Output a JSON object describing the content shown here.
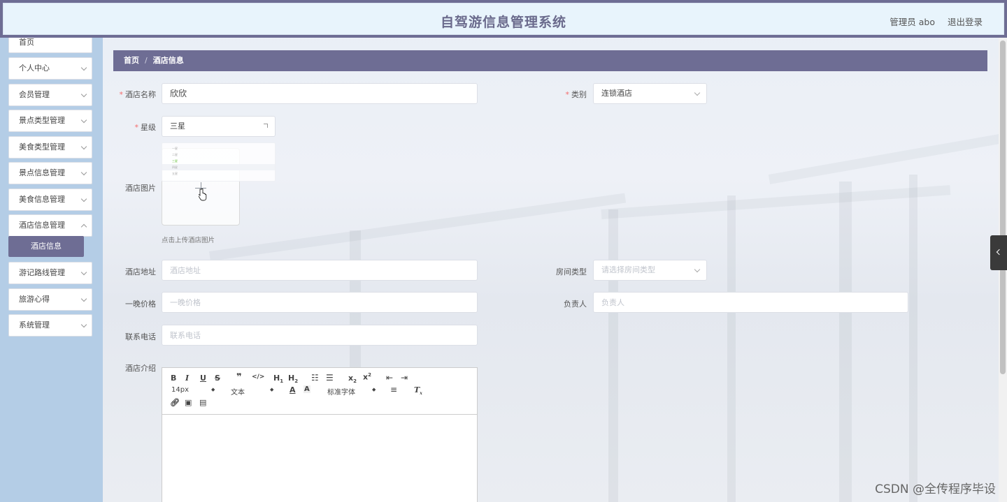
{
  "header": {
    "title": "自驾游信息管理系统",
    "user_label": "管理员 abo",
    "logout_label": "退出登录"
  },
  "sidebar": {
    "items": [
      {
        "label": "首页"
      },
      {
        "label": "个人中心"
      },
      {
        "label": "会员管理"
      },
      {
        "label": "景点类型管理"
      },
      {
        "label": "美食类型管理"
      },
      {
        "label": "景点信息管理"
      },
      {
        "label": "美食信息管理"
      },
      {
        "label": "酒店信息管理"
      },
      {
        "label": "游记路线管理"
      },
      {
        "label": "旅游心得"
      },
      {
        "label": "系统管理"
      }
    ],
    "active_sub": "酒店信息"
  },
  "breadcrumb": {
    "home": "首页",
    "sep": "/",
    "current": "酒店信息"
  },
  "form": {
    "hotel_name": {
      "label": "酒店名称",
      "value": "欣欣"
    },
    "category": {
      "label": "类别",
      "value": "连锁酒店"
    },
    "star": {
      "label": "星级",
      "value": "三星",
      "options": [
        "一星",
        "二星",
        "三星",
        "四星",
        "五星"
      ]
    },
    "image": {
      "label": "酒店图片",
      "tip": "点击上传酒店图片"
    },
    "address": {
      "label": "酒店地址",
      "placeholder": "酒店地址"
    },
    "room_type": {
      "label": "房间类型",
      "placeholder": "请选择房间类型"
    },
    "price": {
      "label": "一晚价格",
      "placeholder": "一晚价格"
    },
    "manager": {
      "label": "负责人",
      "placeholder": "负责人"
    },
    "phone": {
      "label": "联系电话",
      "placeholder": "联系电话"
    },
    "intro": {
      "label": "酒店介绍"
    }
  },
  "editor": {
    "font_size": "14px",
    "text_style": "文本",
    "font_family": "标准字体"
  },
  "watermark": "CSDN @全传程序毕设"
}
